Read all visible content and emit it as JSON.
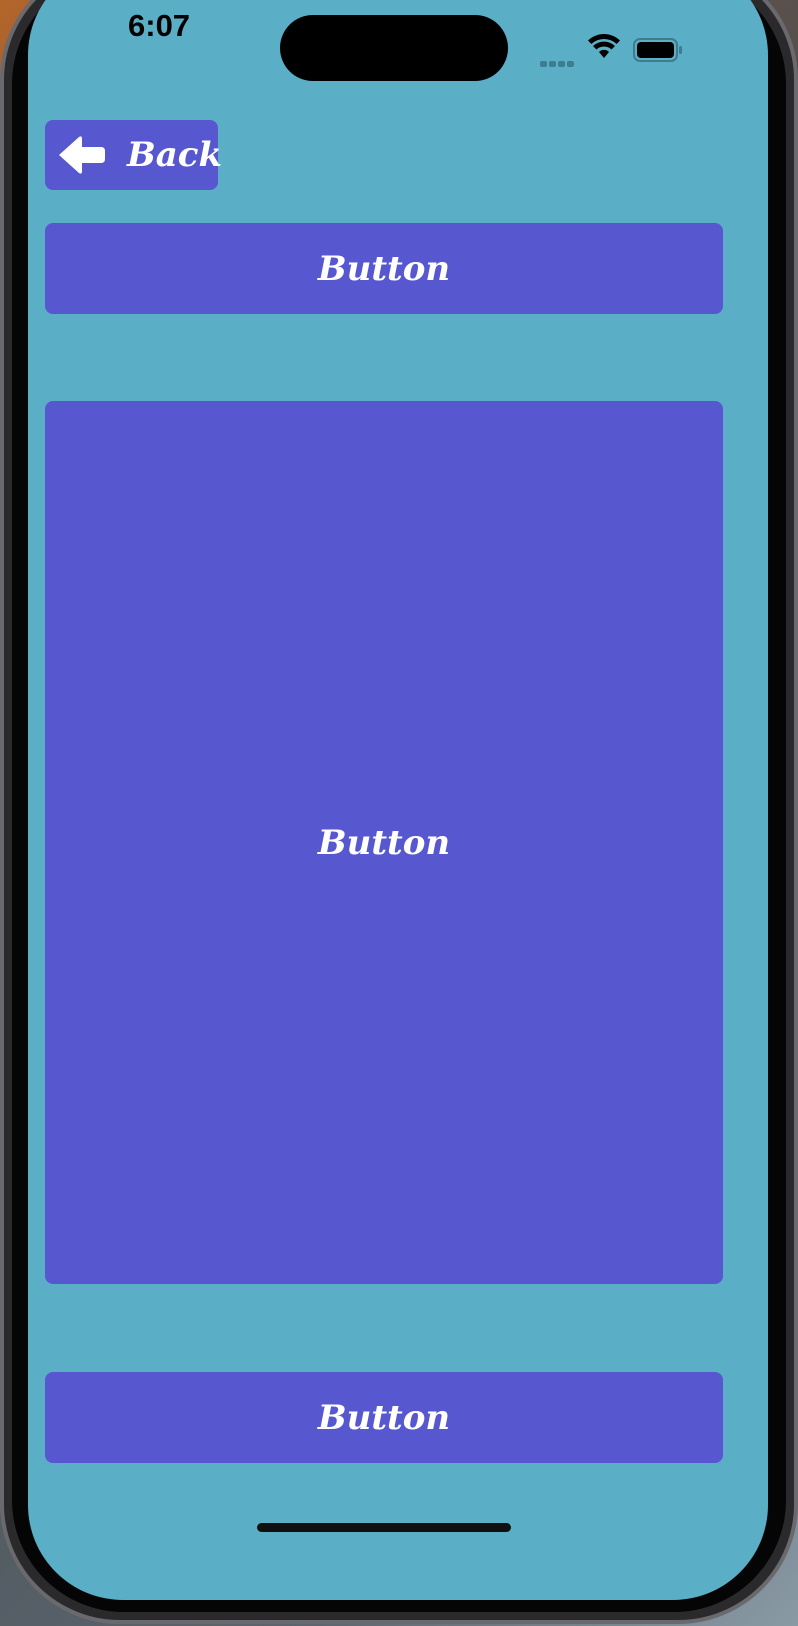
{
  "status_bar": {
    "time": "6:07",
    "wifi_icon": "wifi-icon",
    "battery_icon": "battery-icon",
    "signal_icon": "cellular-signal-icon"
  },
  "nav": {
    "back_label": "Back",
    "back_icon": "arrow-left-icon"
  },
  "buttons": {
    "top_label": "Button",
    "middle_label": "Button",
    "bottom_label": "Button"
  },
  "colors": {
    "screen_background": "#5aaec5",
    "button_background": "#5758d0",
    "button_text": "#ffffff"
  }
}
